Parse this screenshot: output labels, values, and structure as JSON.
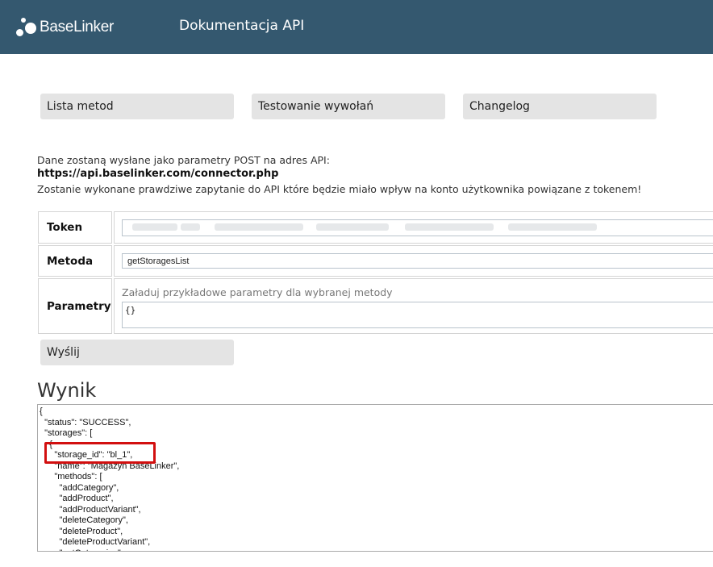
{
  "header": {
    "brand": "BaseLinker",
    "title": "Dokumentacja API",
    "background_color": "#34586f"
  },
  "nav": {
    "methods_label": "Lista metod",
    "testing_label": "Testowanie wywołań",
    "changelog_label": "Changelog"
  },
  "info": {
    "line1": "Dane zostaną wysłane jako parametry POST na adres API:",
    "url": "https://api.baselinker.com/connector.php",
    "line3": "Zostanie wykonane prawdziwe zapytanie do API które będzie miało wpływ na konto użytkownika powiązane z tokenem!"
  },
  "form": {
    "token_label": "Token",
    "method_label": "Metoda",
    "method_value": "getStoragesList",
    "params_label": "Parametry",
    "params_hint": "Załaduj przykładowe parametry dla wybranej metody",
    "params_value": "{}",
    "send_label": "Wyślij"
  },
  "result": {
    "title": "Wynik",
    "lines": [
      "{",
      "  \"status\": \"SUCCESS\",",
      "  \"storages\": [",
      "    {",
      "      \"storage_id\": \"bl_1\",",
      "      \"name\": \"Magazyn BaseLinker\",",
      "      \"methods\": [",
      "        \"addCategory\",",
      "        \"addProduct\",",
      "        \"addProductVariant\",",
      "        \"deleteCategory\",",
      "        \"deleteProduct\",",
      "        \"deleteProductVariant\",",
      "        \"getCategories\","
    ],
    "highlight_color": "#d20f0f"
  }
}
